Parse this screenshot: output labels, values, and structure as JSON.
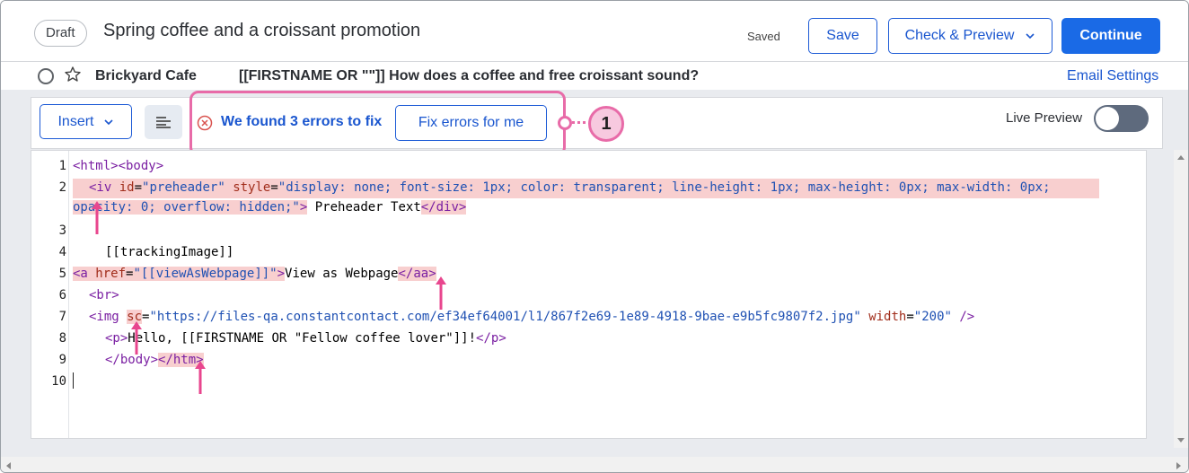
{
  "header": {
    "status_badge": "Draft",
    "title": "Spring coffee and a croissant promotion",
    "saved_label": "Saved",
    "save_button": "Save",
    "check_preview_button": "Check & Preview",
    "continue_button": "Continue"
  },
  "subject_row": {
    "from_name": "Brickyard Cafe",
    "subject": "[[FIRSTNAME OR \"\"]] How does a coffee and free croissant sound?",
    "email_settings_link": "Email Settings"
  },
  "toolbar": {
    "insert_button": "Insert",
    "error_message": "We found 3 errors to fix",
    "fix_errors_button": "Fix errors for me",
    "callout_number": "1",
    "live_preview_label": "Live Preview",
    "live_preview_on": false
  },
  "editor": {
    "line_numbers": [
      "1",
      "2",
      "3",
      "4",
      "5",
      "6",
      "7",
      "8",
      "9",
      "10"
    ],
    "line1": {
      "open_html": "<html>",
      "open_body": "<body>"
    },
    "line2": {
      "tag_open": "<iv",
      "attr_id": "id",
      "eq": "=",
      "val_id": "\"preheader\"",
      "attr_style": "style",
      "val_style_a": "\"display: none; font-size: 1px; color: transparent; line-height: 1px; max-height: 0px; max-width: 0px;",
      "val_style_b": "opacity: 0; overflow: hidden;\"",
      "tag_close_bracket": ">",
      "text": " Preheader Text",
      "close_tag": "</div>"
    },
    "line4": {
      "text": "[[trackingImage]]"
    },
    "line5": {
      "tag_open": "<a",
      "attr_href": "href",
      "eq": "=",
      "val_href": "\"[[viewAsWebpage]]\"",
      "bracket": ">",
      "text": "View as Webpage",
      "close_tag": "</aa>"
    },
    "line6": {
      "tag": "<br>"
    },
    "line7": {
      "tag_open": "<img",
      "attr_src": "sc",
      "eq": "=",
      "val_src": "\"https://files-qa.constantcontact.com/ef34ef64001/l1/867f2e69-1e89-4918-9bae-e9b5fc9807f2.jpg\"",
      "attr_width": "width",
      "val_width": "\"200\"",
      "self_close": " />"
    },
    "line8": {
      "open_p": "<p>",
      "text": "Hello, [[FIRSTNAME OR \"Fellow coffee lover\"]]!",
      "close_p": "</p>"
    },
    "line9": {
      "close_body": "</body>",
      "close_html": "</htm>"
    }
  },
  "colors": {
    "brand_blue": "#1a6ae6",
    "link_blue": "#1a56cf",
    "callout_pink": "#e86ba8",
    "error_highlight": "#f8cfcf"
  }
}
